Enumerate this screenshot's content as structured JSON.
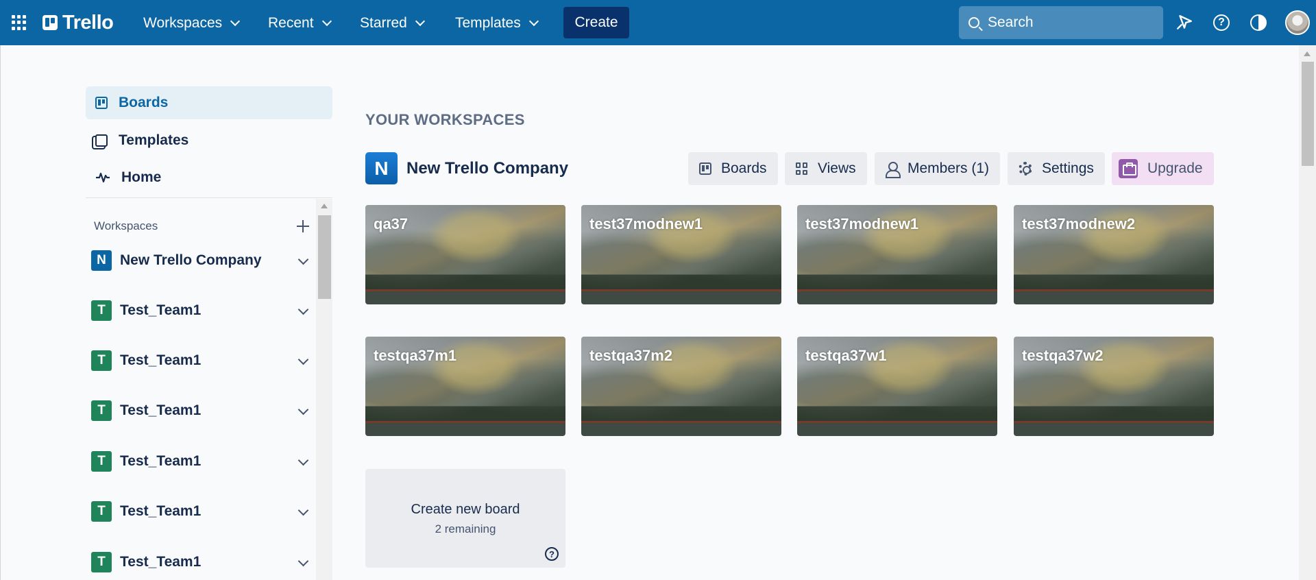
{
  "header": {
    "brand": "Trello",
    "nav": [
      {
        "label": "Workspaces"
      },
      {
        "label": "Recent"
      },
      {
        "label": "Starred"
      },
      {
        "label": "Templates"
      }
    ],
    "create_label": "Create",
    "search_placeholder": "Search",
    "help_glyph": "?",
    "icons": [
      "apps-icon",
      "notifications-icon",
      "help-icon",
      "theme-icon",
      "avatar"
    ]
  },
  "sidebar": {
    "links": [
      {
        "label": "Boards",
        "icon": "board-icon",
        "active": true
      },
      {
        "label": "Templates",
        "icon": "template-icon"
      },
      {
        "label": "Home",
        "icon": "pulse-icon"
      }
    ],
    "workspaces_title": "Workspaces",
    "workspaces": [
      {
        "initial": "N",
        "name": "New Trello Company",
        "color": "#0c66a4"
      },
      {
        "initial": "T",
        "name": "Test_Team1",
        "color": "#1f845a"
      },
      {
        "initial": "T",
        "name": "Test_Team1",
        "color": "#1f845a"
      },
      {
        "initial": "T",
        "name": "Test_Team1",
        "color": "#1f845a"
      },
      {
        "initial": "T",
        "name": "Test_Team1",
        "color": "#1f845a"
      },
      {
        "initial": "T",
        "name": "Test_Team1",
        "color": "#1f845a"
      },
      {
        "initial": "T",
        "name": "Test_Team1",
        "color": "#1f845a"
      }
    ]
  },
  "main": {
    "section_title": "YOUR WORKSPACES",
    "workspace": {
      "initial": "N",
      "name": "New Trello Company",
      "buttons": {
        "boards": "Boards",
        "views": "Views",
        "members": "Members (1)",
        "settings": "Settings",
        "upgrade": "Upgrade"
      }
    },
    "boards": [
      {
        "title": "qa37"
      },
      {
        "title": "test37modnew1"
      },
      {
        "title": "test37modnew1"
      },
      {
        "title": "test37modnew2"
      },
      {
        "title": "testqa37m1"
      },
      {
        "title": "testqa37m2"
      },
      {
        "title": "testqa37w1"
      },
      {
        "title": "testqa37w2"
      }
    ],
    "create_board": {
      "label": "Create new board",
      "remaining": "2 remaining",
      "help_glyph": "?"
    }
  },
  "colors": {
    "header_bg": "#0c66a4",
    "create_bg": "#09326c",
    "active_link_bg": "#e4f0f6",
    "upgrade_bg": "#f3dff4"
  }
}
